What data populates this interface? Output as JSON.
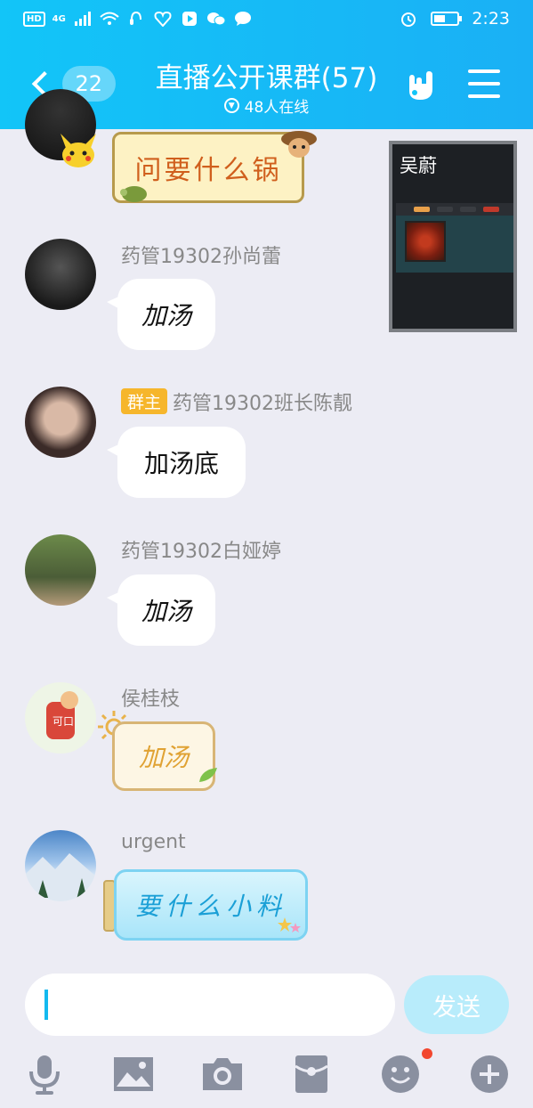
{
  "status_bar": {
    "hd": "HD",
    "net": "4G",
    "time": "2:23"
  },
  "header": {
    "back_count": "22",
    "title": "直播公开课群(57)",
    "online": "48人在线"
  },
  "video_window": {
    "presenter": "吴蔚"
  },
  "messages": [
    {
      "type": "sticker",
      "text": "问要什么锅"
    },
    {
      "sender": "药管19302孙尚蕾",
      "text": "加汤"
    },
    {
      "badge": "群主",
      "sender": "药管19302班长陈靓",
      "text": "加汤底"
    },
    {
      "sender": "药管19302白娅婷",
      "text": "加汤"
    },
    {
      "sender": "侯桂枝",
      "text": "加汤",
      "type": "sticker"
    },
    {
      "sender": "urgent",
      "text": "要什么小料",
      "type": "sticker"
    }
  ],
  "composer": {
    "send_label": "发送"
  },
  "colors": {
    "header": "#12c5f8",
    "background": "#ececf4",
    "owner_badge": "#f6b62c",
    "send_disabled": "#b8ecfb",
    "notification_dot": "#f2472f"
  },
  "icons": [
    "microphone-icon",
    "image-icon",
    "camera-icon",
    "red-packet-icon",
    "emoji-icon",
    "plus-icon"
  ]
}
